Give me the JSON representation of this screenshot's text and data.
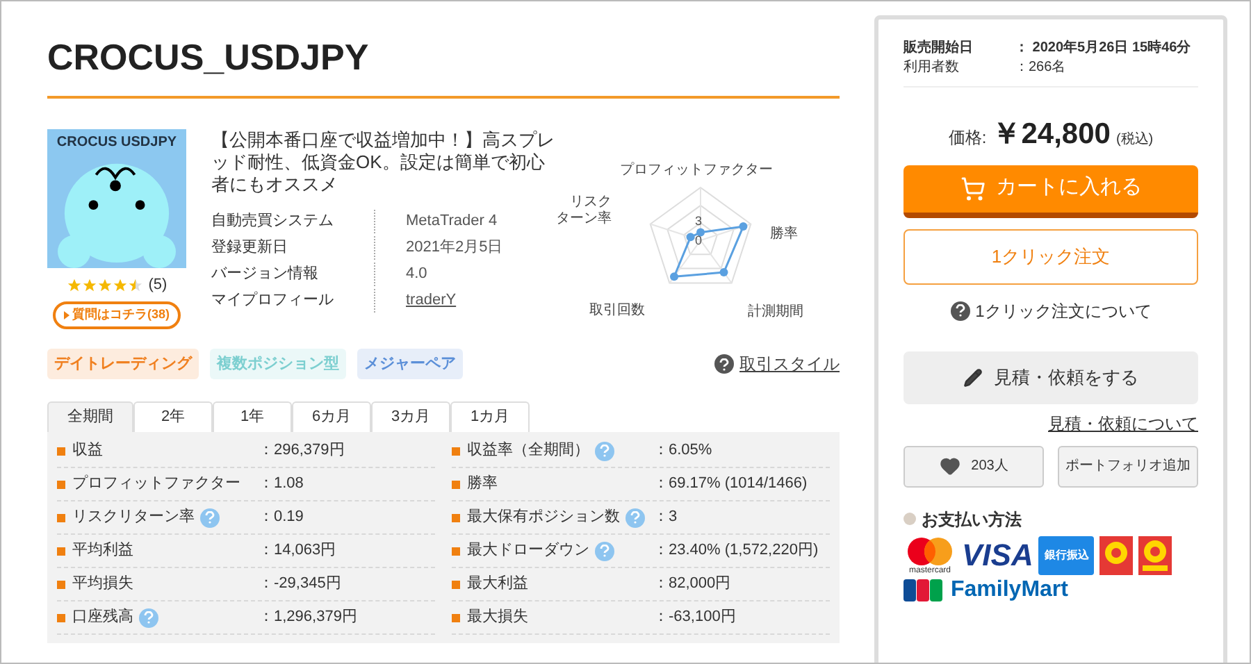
{
  "title": "CROCUS_USDJPY",
  "product": {
    "image_caption": "CROCUS USDJPY",
    "stars": 4.5,
    "review_count": "(5)",
    "question_link": "質問はコチラ(38)",
    "headline": "【公開本番口座で収益増加中！】高スプレッド耐性、低資金OK。設定は簡単で初心者にもオススメ",
    "specs": [
      {
        "label": "自動売買システム",
        "value": "MetaTrader 4",
        "kind": "text"
      },
      {
        "label": "登録更新日",
        "value": "2021年2月5日",
        "kind": "text"
      },
      {
        "label": "バージョン情報",
        "value": "4.0",
        "kind": "text"
      },
      {
        "label": "マイプロフィール",
        "value": "traderY",
        "kind": "link"
      }
    ]
  },
  "radar": {
    "labels": [
      "プロフィットファクター",
      "勝率",
      "計測期間",
      "取引回数"
    ],
    "left_label_lines": [
      "リスク",
      "ターン率"
    ],
    "tick_high": "3",
    "tick_low": "0"
  },
  "tags": [
    {
      "label": "デイトレーディング",
      "color": "#f08020"
    },
    {
      "label": "複数ポジション型",
      "color": "#7ccfd0"
    },
    {
      "label": "メジャーペア",
      "color": "#5b8fd8"
    }
  ],
  "style_link": "取引スタイル",
  "tabs": [
    {
      "label": "全期間",
      "selected": true
    },
    {
      "label": "2年",
      "selected": false
    },
    {
      "label": "1年",
      "selected": false
    },
    {
      "label": "6カ月",
      "selected": false
    },
    {
      "label": "3カ月",
      "selected": false
    },
    {
      "label": "1カ月",
      "selected": false
    }
  ],
  "stats_left": [
    {
      "label": "収益",
      "value": "：296,379円",
      "help": false
    },
    {
      "label": "プロフィットファクター",
      "value": "：1.08",
      "help": false
    },
    {
      "label": "リスクリターン率",
      "value": "：0.19",
      "help": true
    },
    {
      "label": "平均利益",
      "value": "：14,063円",
      "help": false
    },
    {
      "label": "平均損失",
      "value": "：-29,345円",
      "help": false
    },
    {
      "label": "口座残高",
      "value": "：1,296,379円",
      "help": true
    }
  ],
  "stats_right": [
    {
      "label": "収益率（全期間）",
      "value": "：6.05%",
      "help": true
    },
    {
      "label": "勝率",
      "value": "：69.17% (1014/1466)",
      "help": false
    },
    {
      "label": "最大保有ポジション数",
      "value": "：3",
      "help": true
    },
    {
      "label": "最大ドローダウン",
      "value": "：23.40% (1,572,220円)",
      "help": true
    },
    {
      "label": "最大利益",
      "value": "：82,000円",
      "help": false
    },
    {
      "label": "最大損失",
      "value": "：-63,100円",
      "help": false
    }
  ],
  "sidebar": {
    "info": [
      {
        "label": "販売開始日",
        "value": "：  2020年5月26日 15時46分",
        "bold": true
      },
      {
        "label": "利用者数",
        "value": "：266名",
        "bold": false
      }
    ],
    "price_label": "価格:",
    "price": "￥24,800",
    "tax": "(税込)",
    "cart_button": "カートに入れる",
    "one_click_button": "1クリック注文",
    "one_click_help": "1クリック注文について",
    "estimate_button": "見積・依頼をする",
    "estimate_link": "見積・依頼について",
    "favorite_count": "203人",
    "portfolio_button": "ポートフォリオ追加",
    "payment_title": "お支払い方法",
    "payment_labels": {
      "mastercard": "mastercard",
      "visa": "VISA",
      "bank": "銀行振込",
      "family": "FamilyMart"
    }
  }
}
